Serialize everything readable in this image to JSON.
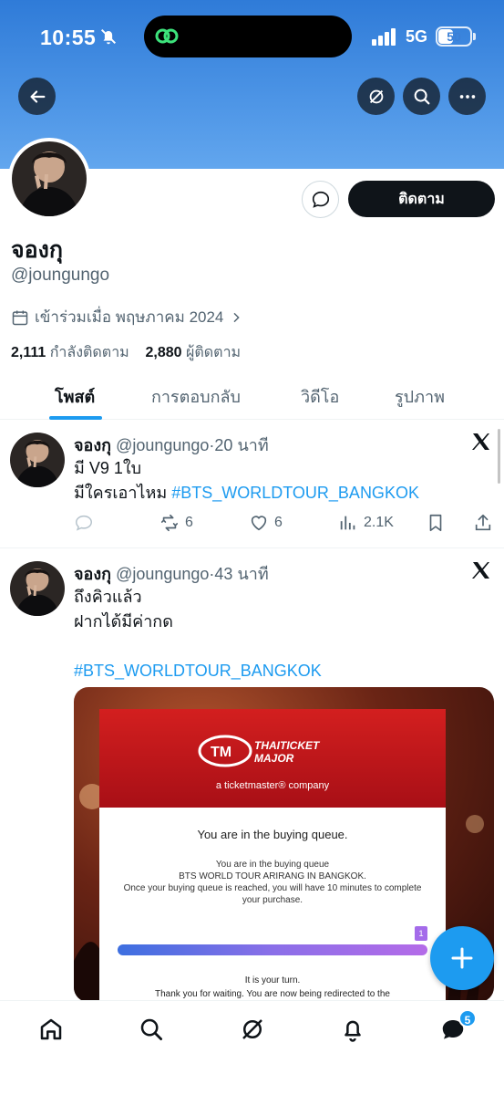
{
  "status_bar": {
    "time": "10:55",
    "network": "5G",
    "battery": "50",
    "battery_level": 0.5
  },
  "profile": {
    "display_name": "จองกุ",
    "handle": "@joungungo",
    "joined": "เข้าร่วมเมื่อ พฤษภาคม 2024",
    "following_count": "2,111",
    "following_label": "กำลังติดตาม",
    "followers_count": "2,880",
    "followers_label": "ผู้ติดตาม",
    "follow_label": "ติดตาม"
  },
  "tabs": [
    {
      "label": "โพสต์",
      "active": true
    },
    {
      "label": "การตอบกลับ",
      "active": false
    },
    {
      "label": "วิดีโอ",
      "active": false
    },
    {
      "label": "รูปภาพ",
      "active": false
    }
  ],
  "posts": [
    {
      "name": "จองกุ",
      "handle": "@joungungo",
      "separator": "·",
      "time": "20 นาที",
      "line1": "มี V9 1ใบ",
      "line2": "มีใครเอาไหม ",
      "hashtag": "#BTS_WORLDTOUR_BANGKOK",
      "retweets": "6",
      "likes": "6",
      "views": "2.1K"
    },
    {
      "name": "จองกุ",
      "handle": "@joungungo",
      "separator": "·",
      "time": "43 นาที",
      "line1": "ถึงคิวแล้ว",
      "line2": "ฝากได้มีค่ากด",
      "hashtag": "#BTS_WORLDTOUR_BANGKOK",
      "media": {
        "logo_text": "THAITICKET MAJOR",
        "logo_sub": "a ticketmaster® company",
        "title": "You are in the buying queue.",
        "body_1": "You are in the buying queue",
        "body_2": "BTS WORLD TOUR ARIRANG IN BANGKOK.",
        "body_3": "Once your buying queue is reached, you will have 10 minutes to complete your purchase.",
        "flag": "1",
        "turn": "It is your turn.",
        "wait": "Thank you for waiting. You are now being redirected to the"
      }
    }
  ],
  "nav": {
    "messages_badge": "5"
  },
  "icons": [
    "back-arrow-icon",
    "grok-icon",
    "search-icon",
    "more-icon",
    "message-icon",
    "calendar-icon",
    "chevron-right-icon",
    "x-logo-icon",
    "reply-icon",
    "retweet-icon",
    "like-icon",
    "views-icon",
    "bookmark-icon",
    "share-icon",
    "compose-plus-icon",
    "home-icon",
    "nav-search-icon",
    "nav-grok-icon",
    "notifications-icon",
    "messages-icon"
  ],
  "colors": {
    "accent": "#1d9bf0",
    "banner": "#3f88e0",
    "text": "#0f1419",
    "muted": "#536471"
  }
}
